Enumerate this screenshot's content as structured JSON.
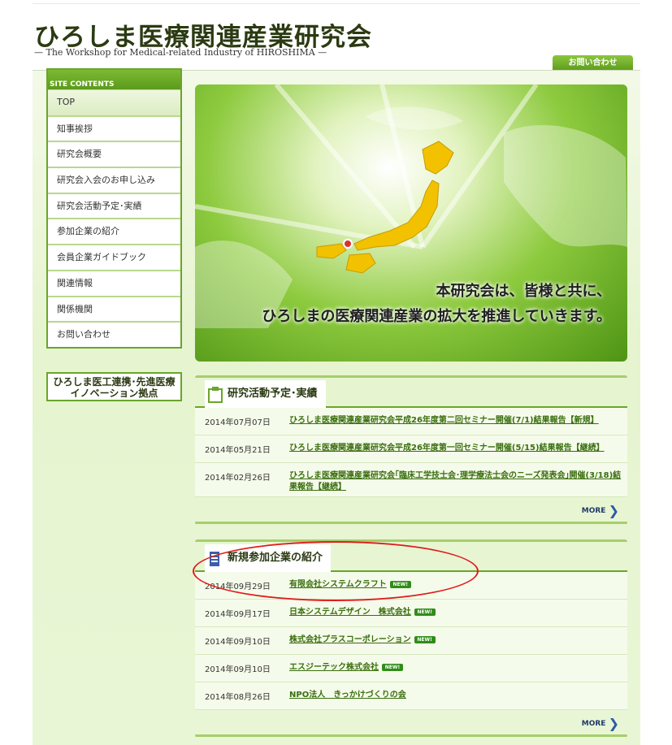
{
  "header": {
    "title": "ひろしま医療関連産業研究会",
    "subtitle": "— The Workshop for Medical-related Industry of HIROSHIMA —",
    "contact_button": "お問い合わせ"
  },
  "sidebar": {
    "heading": "SITE CONTENTS",
    "items": [
      {
        "label": "TOP",
        "active": true
      },
      {
        "label": "知事挨拶"
      },
      {
        "label": "研究会概要"
      },
      {
        "label": "研究会入会のお申し込み"
      },
      {
        "label": "研究会活動予定･実績"
      },
      {
        "label": "参加企業の紹介"
      },
      {
        "label": "会員企業ガイドブック"
      },
      {
        "label": "関連情報"
      },
      {
        "label": "関係機関"
      },
      {
        "label": "お問い合わせ"
      }
    ],
    "banner_line1": "ひろしま医工連携･先進医療",
    "banner_line2": "イノベーション拠点"
  },
  "hero": {
    "line1": "本研究会は、皆様と共に、",
    "line2": "ひろしまの医療関連産業の拡大を推進していきます。",
    "map_color": "#f2c200"
  },
  "activities": {
    "title": "研究活動予定･実績",
    "items": [
      {
        "date": "2014年07月07日",
        "text": "ひろしま医療関連産業研究会平成26年度第二回セミナー開催(7/1)結果報告【新規】"
      },
      {
        "date": "2014年05月21日",
        "text": "ひろしま医療関連産業研究会平成26年度第一回セミナー開催(5/15)結果報告【継続】"
      },
      {
        "date": "2014年02月26日",
        "text": "ひろしま医療関連産業研究会｢臨床工学技士会･理学療法士会のニーズ発表会｣開催(3/18)結果報告【継続】"
      }
    ],
    "more_label": "MORE"
  },
  "members": {
    "title": "新規参加企業の紹介",
    "badge_label": "NEW!",
    "items": [
      {
        "date": "2014年09月29日",
        "text": "有限会社システムクラフト",
        "new": true
      },
      {
        "date": "2014年09月17日",
        "text": "日本システムデザイン　株式会社",
        "new": true
      },
      {
        "date": "2014年09月10日",
        "text": "株式会社プラスコーポレーション",
        "new": true
      },
      {
        "date": "2014年09月10日",
        "text": "エスジーテック株式会社",
        "new": true
      },
      {
        "date": "2014年08月26日",
        "text": "NPO法人　きっかけづくりの会",
        "new": false
      }
    ],
    "more_label": "MORE"
  },
  "colors": {
    "accent": "#6aa52a",
    "link": "#3a6e0f",
    "annotation": "#e01c1c"
  }
}
